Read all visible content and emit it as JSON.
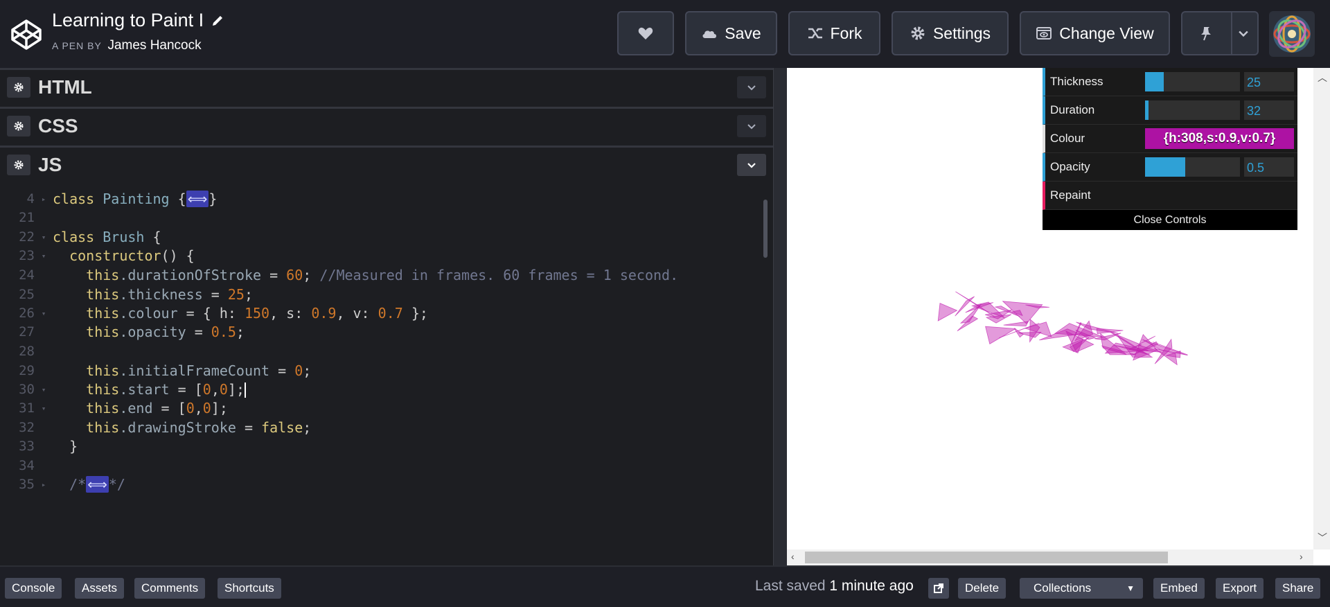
{
  "header": {
    "title": "Learning to Paint I",
    "byline_prefix": "A PEN BY",
    "author": "James Hancock",
    "buttons": {
      "save": "Save",
      "fork": "Fork",
      "settings": "Settings",
      "change_view": "Change View"
    }
  },
  "panels": {
    "html": "HTML",
    "css": "CSS",
    "js": "JS"
  },
  "code": {
    "lines": [
      {
        "n": "4",
        "fold": "▸"
      },
      {
        "n": "21",
        "fold": ""
      },
      {
        "n": "22",
        "fold": "▾"
      },
      {
        "n": "23",
        "fold": "▾"
      },
      {
        "n": "24",
        "fold": ""
      },
      {
        "n": "25",
        "fold": ""
      },
      {
        "n": "26",
        "fold": "▾"
      },
      {
        "n": "27",
        "fold": ""
      },
      {
        "n": "28",
        "fold": ""
      },
      {
        "n": "29",
        "fold": ""
      },
      {
        "n": "30",
        "fold": "▾"
      },
      {
        "n": "31",
        "fold": "▾"
      },
      {
        "n": "32",
        "fold": ""
      },
      {
        "n": "33",
        "fold": ""
      },
      {
        "n": "34",
        "fold": ""
      },
      {
        "n": "35",
        "fold": "▸"
      }
    ],
    "tokens": {
      "class_kw": "class",
      "painting": "Painting",
      "brush": "Brush",
      "widget": "⟺",
      "constructor": "constructor",
      "this": "this",
      "durationOfStroke": ".durationOfStroke",
      "duration_val": "60",
      "comment": "//Measured in frames. 60 frames = 1 second.",
      "thickness": ".thickness",
      "thickness_val": "25",
      "colour": ".colour",
      "h_val": "150",
      "s_val": "0.9",
      "v_val": "0.7",
      "opacity": ".opacity",
      "opacity_val": "0.5",
      "initialFrameCount": ".initialFrameCount",
      "zero": "0",
      "start": ".start",
      "end": ".end",
      "drawingStroke": ".drawingStroke",
      "false_kw": "false"
    }
  },
  "gui": {
    "thickness": {
      "label": "Thickness",
      "value": "25",
      "fill": 0.2
    },
    "duration": {
      "label": "Duration",
      "value": "32",
      "fill": 0.04
    },
    "colour": {
      "label": "Colour",
      "value": "{h:308,s:0.9,v:0.7}"
    },
    "opacity": {
      "label": "Opacity",
      "value": "0.5",
      "fill": 0.42
    },
    "repaint": {
      "label": "Repaint"
    },
    "close": "Close Controls"
  },
  "footer": {
    "console": "Console",
    "assets": "Assets",
    "comments": "Comments",
    "shortcuts": "Shortcuts",
    "saved_prefix": "Last saved",
    "saved_time": "1 minute ago",
    "delete": "Delete",
    "collections": "Collections",
    "embed": "Embed",
    "export": "Export",
    "share": "Share"
  },
  "colors": {
    "accent": "#2fa1d6",
    "paint": "#c020b0",
    "colour_swatch": "#ad12a3"
  }
}
